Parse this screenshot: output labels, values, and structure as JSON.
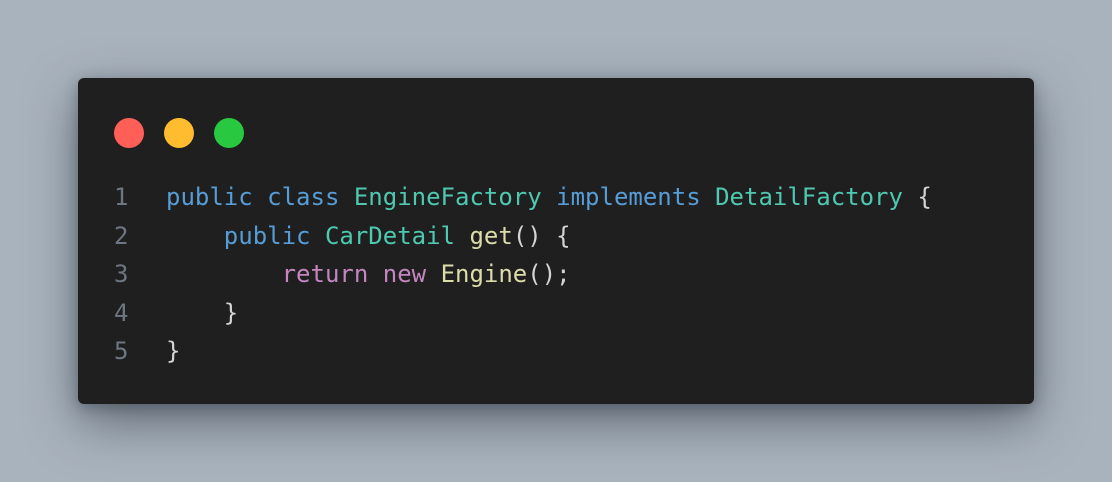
{
  "colors": {
    "background": "#a9b3bd",
    "window": "#1f1f1f",
    "close": "#ff5f57",
    "minimize": "#febc2e",
    "maximize": "#28c840",
    "line_number": "#6e7681",
    "keyword": "#569cd6",
    "type": "#4ec9b0",
    "control": "#c586c0",
    "function": "#dcdcaa",
    "punctuation": "#d4d4d4"
  },
  "window_controls": [
    {
      "name": "close-dot",
      "color": "#ff5f57"
    },
    {
      "name": "minimize-dot",
      "color": "#febc2e"
    },
    {
      "name": "maximize-dot",
      "color": "#28c840"
    }
  ],
  "code": {
    "lines": [
      {
        "number": "1",
        "indent": "",
        "tokens": [
          {
            "text": "public",
            "kind": "keyword"
          },
          {
            "text": " ",
            "kind": "punctuation"
          },
          {
            "text": "class",
            "kind": "keyword"
          },
          {
            "text": " ",
            "kind": "punctuation"
          },
          {
            "text": "EngineFactory",
            "kind": "type"
          },
          {
            "text": " ",
            "kind": "punctuation"
          },
          {
            "text": "implements",
            "kind": "keyword"
          },
          {
            "text": " ",
            "kind": "punctuation"
          },
          {
            "text": "DetailFactory",
            "kind": "type"
          },
          {
            "text": " {",
            "kind": "punctuation"
          }
        ]
      },
      {
        "number": "2",
        "indent": "    ",
        "tokens": [
          {
            "text": "public",
            "kind": "keyword"
          },
          {
            "text": " ",
            "kind": "punctuation"
          },
          {
            "text": "CarDetail",
            "kind": "type"
          },
          {
            "text": " ",
            "kind": "punctuation"
          },
          {
            "text": "get",
            "kind": "function"
          },
          {
            "text": "() {",
            "kind": "punctuation"
          }
        ]
      },
      {
        "number": "3",
        "indent": "        ",
        "tokens": [
          {
            "text": "return",
            "kind": "control"
          },
          {
            "text": " ",
            "kind": "punctuation"
          },
          {
            "text": "new",
            "kind": "control"
          },
          {
            "text": " ",
            "kind": "punctuation"
          },
          {
            "text": "Engine",
            "kind": "function"
          },
          {
            "text": "();",
            "kind": "punctuation"
          }
        ]
      },
      {
        "number": "4",
        "indent": "    ",
        "tokens": [
          {
            "text": "}",
            "kind": "punctuation"
          }
        ]
      },
      {
        "number": "5",
        "indent": "",
        "tokens": [
          {
            "text": "}",
            "kind": "punctuation"
          }
        ]
      }
    ]
  }
}
